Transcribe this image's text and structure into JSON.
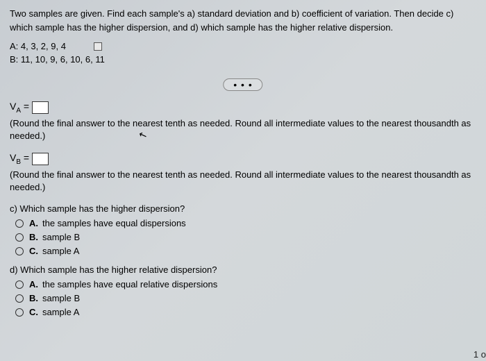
{
  "question_header": "Two samples are given. Find each sample's a) standard deviation and b) coefficient of variation. Then decide c) which sample has the higher dispersion, and d) which sample has the higher relative dispersion.",
  "sample_a": "A: 4, 3, 2, 9, 4",
  "sample_b": "B: 11, 10, 9, 6, 10, 6, 11",
  "dots": "• • •",
  "va_label": "V",
  "va_sub": "A",
  "vb_label": "V",
  "vb_sub": "B",
  "equals": " = ",
  "rounding_note": "(Round the final answer to the nearest tenth as needed. Round all intermediate values to the nearest thousandth as needed.)",
  "cursor": "↖",
  "part_c": {
    "question": "c) Which sample has the higher dispersion?",
    "options": [
      {
        "letter": "A.",
        "text": "the samples have equal dispersions"
      },
      {
        "letter": "B.",
        "text": "sample B"
      },
      {
        "letter": "C.",
        "text": "sample A"
      }
    ]
  },
  "part_d": {
    "question": "d) Which sample has the higher relative dispersion?",
    "options": [
      {
        "letter": "A.",
        "text": "the samples have equal relative dispersions"
      },
      {
        "letter": "B.",
        "text": "sample B"
      },
      {
        "letter": "C.",
        "text": "sample A"
      }
    ]
  },
  "corner": "1 o"
}
